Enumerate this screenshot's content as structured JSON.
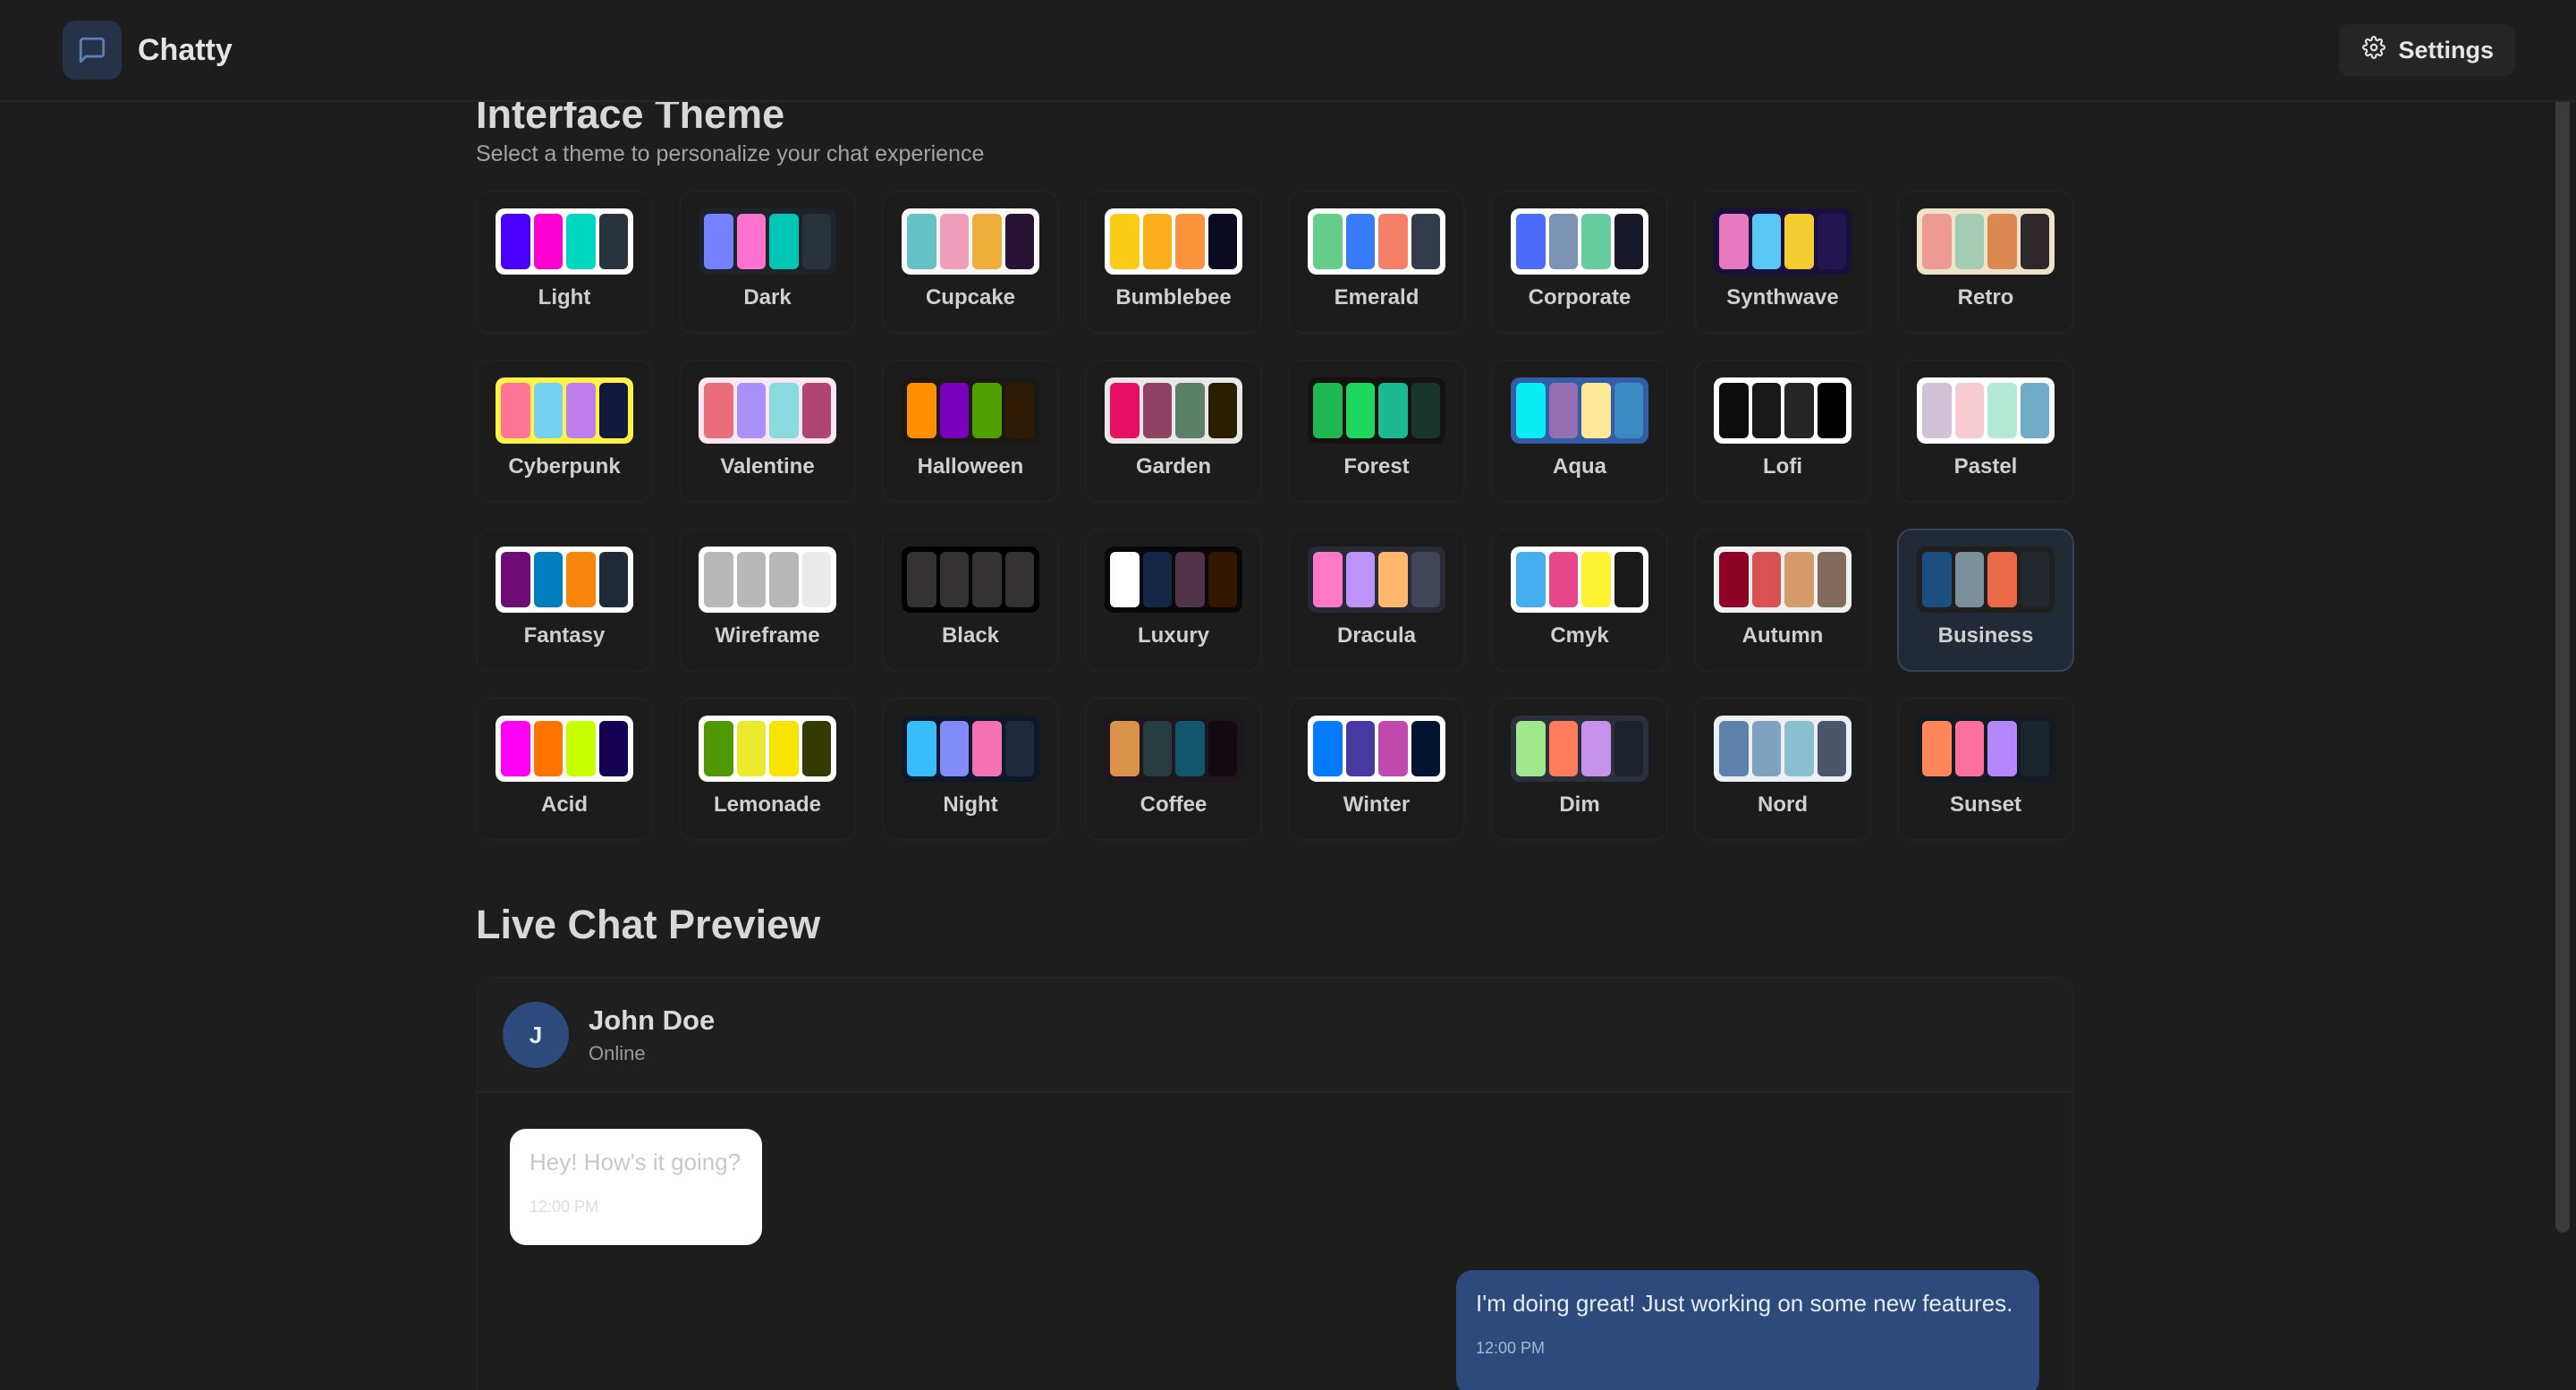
{
  "app": {
    "name": "Chatty"
  },
  "nav": {
    "settings_label": "Settings"
  },
  "theme_section": {
    "title": "Interface Theme",
    "subtitle": "Select a theme to personalize your chat experience",
    "selected": "Business",
    "themes": [
      {
        "name": "Light",
        "bg": "#ffffff",
        "colors": [
          "#4a00ff",
          "#ff00d3",
          "#00d7c0",
          "#2a323c"
        ]
      },
      {
        "name": "Dark",
        "bg": "#1d232a",
        "colors": [
          "#7582ff",
          "#ff71cf",
          "#00c7b5",
          "#2a323c"
        ]
      },
      {
        "name": "Cupcake",
        "bg": "#faf7f5",
        "colors": [
          "#65c3c8",
          "#ef9fbc",
          "#eeaf3a",
          "#291334"
        ]
      },
      {
        "name": "Bumblebee",
        "bg": "#ffffff",
        "colors": [
          "#facc15",
          "#fbaf1a",
          "#fb923c",
          "#0a0a23"
        ]
      },
      {
        "name": "Emerald",
        "bg": "#ffffff",
        "colors": [
          "#66cc8a",
          "#377cfb",
          "#f68067",
          "#333c4d"
        ]
      },
      {
        "name": "Corporate",
        "bg": "#ffffff",
        "colors": [
          "#4b6bfb",
          "#7b92b2",
          "#67cba0",
          "#181a2a"
        ]
      },
      {
        "name": "Synthwave",
        "bg": "#1a103d",
        "colors": [
          "#e779c1",
          "#58c7f3",
          "#f3cc30",
          "#221551"
        ]
      },
      {
        "name": "Retro",
        "bg": "#ece3ca",
        "colors": [
          "#ef9995",
          "#a4cbb4",
          "#dc8850",
          "#2e282a"
        ]
      },
      {
        "name": "Cyberpunk",
        "bg": "#fff248",
        "colors": [
          "#ff7598",
          "#75d1f0",
          "#c07eec",
          "#111a3b"
        ]
      },
      {
        "name": "Valentine",
        "bg": "#fae7f4",
        "colors": [
          "#e96d7b",
          "#a991f7",
          "#88dbdd",
          "#af4670"
        ]
      },
      {
        "name": "Halloween",
        "bg": "#1b1816",
        "colors": [
          "#ff8f00",
          "#7a00bd",
          "#4fa000",
          "#2f1b05"
        ]
      },
      {
        "name": "Garden",
        "bg": "#e9e7e7",
        "colors": [
          "#e70f62",
          "#8e4162",
          "#5c7f67",
          "#291e00"
        ]
      },
      {
        "name": "Forest",
        "bg": "#171212",
        "colors": [
          "#1eb854",
          "#1fd65f",
          "#1db990",
          "#19362d"
        ]
      },
      {
        "name": "Aqua",
        "bg": "#345da7",
        "colors": [
          "#09ecf3",
          "#966fb3",
          "#ffe999",
          "#3b8ac4"
        ]
      },
      {
        "name": "Lofi",
        "bg": "#ffffff",
        "colors": [
          "#0d0d0d",
          "#1a1919",
          "#262626",
          "#000000"
        ]
      },
      {
        "name": "Pastel",
        "bg": "#ffffff",
        "colors": [
          "#d1c1d7",
          "#f6cbd1",
          "#b4e9d6",
          "#70acc7"
        ]
      },
      {
        "name": "Fantasy",
        "bg": "#ffffff",
        "colors": [
          "#6e0b75",
          "#007ebd",
          "#f8860d",
          "#1f2937"
        ]
      },
      {
        "name": "Wireframe",
        "bg": "#ffffff",
        "colors": [
          "#b8b8b8",
          "#b8b8b8",
          "#b8b8b8",
          "#ebebeb"
        ]
      },
      {
        "name": "Black",
        "bg": "#000000",
        "colors": [
          "#343232",
          "#343232",
          "#343232",
          "#343232"
        ]
      },
      {
        "name": "Luxury",
        "bg": "#09090b",
        "colors": [
          "#ffffff",
          "#152747",
          "#513448",
          "#331800"
        ]
      },
      {
        "name": "Dracula",
        "bg": "#282a36",
        "colors": [
          "#ff79c6",
          "#bd93f9",
          "#ffb86c",
          "#414558"
        ]
      },
      {
        "name": "Cmyk",
        "bg": "#ffffff",
        "colors": [
          "#45aeee",
          "#e8488a",
          "#fff232",
          "#1a1a1a"
        ]
      },
      {
        "name": "Autumn",
        "bg": "#f1f1f1",
        "colors": [
          "#8c0327",
          "#d85251",
          "#d59b6a",
          "#826a5c"
        ]
      },
      {
        "name": "Business",
        "bg": "#202020",
        "colors": [
          "#1c4e80",
          "#7c909a",
          "#ea6947",
          "#23282e"
        ]
      },
      {
        "name": "Acid",
        "bg": "#fafafa",
        "colors": [
          "#ff00f4",
          "#ff7400",
          "#c8ff00",
          "#140152"
        ]
      },
      {
        "name": "Lemonade",
        "bg": "#ffffff",
        "colors": [
          "#519903",
          "#e9e92e",
          "#f7e500",
          "#353a00"
        ]
      },
      {
        "name": "Night",
        "bg": "#0f172a",
        "colors": [
          "#38bdf8",
          "#818cf8",
          "#f471b5",
          "#1e293b"
        ]
      },
      {
        "name": "Coffee",
        "bg": "#20161f",
        "colors": [
          "#db924b",
          "#263e3f",
          "#10576d",
          "#120c12"
        ]
      },
      {
        "name": "Winter",
        "bg": "#ffffff",
        "colors": [
          "#047aff",
          "#463aa2",
          "#c148ac",
          "#021431"
        ]
      },
      {
        "name": "Dim",
        "bg": "#2a303c",
        "colors": [
          "#9fe88d",
          "#ff7d5c",
          "#c792e9",
          "#1c212b"
        ]
      },
      {
        "name": "Nord",
        "bg": "#eceff4",
        "colors": [
          "#5e81ac",
          "#81a1c1",
          "#88c0d0",
          "#4c566a"
        ]
      },
      {
        "name": "Sunset",
        "bg": "#121c22",
        "colors": [
          "#ff865b",
          "#fd6f9c",
          "#b387fa",
          "#1b262c"
        ]
      }
    ]
  },
  "preview": {
    "title": "Live Chat Preview",
    "contact": {
      "initial": "J",
      "name": "John Doe",
      "status": "Online"
    },
    "messages": [
      {
        "text": "Hey! How's it going?",
        "time": "12:00 PM",
        "sent": false
      },
      {
        "text": "I'm doing great! Just working on some new features.",
        "time": "12:00 PM",
        "sent": true
      }
    ]
  }
}
